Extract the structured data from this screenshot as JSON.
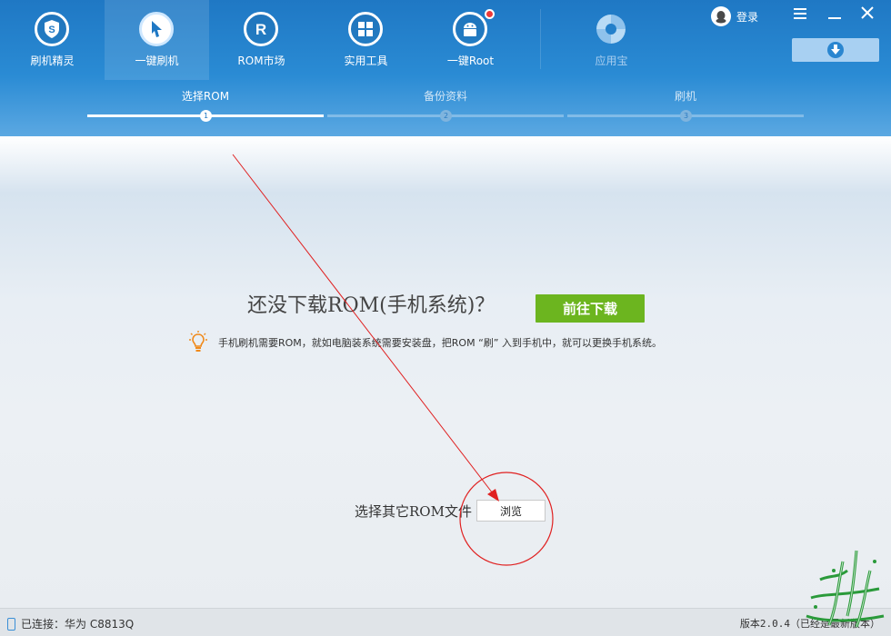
{
  "nav": {
    "items": [
      {
        "label": "刷机精灵",
        "icon": "shield-s-icon"
      },
      {
        "label": "一键刷机",
        "icon": "cursor-icon"
      },
      {
        "label": "ROM市场",
        "icon": "r-letter-icon"
      },
      {
        "label": "实用工具",
        "icon": "grid-icon"
      },
      {
        "label": "一键Root",
        "icon": "android-icon"
      }
    ],
    "active_index": 1,
    "app": {
      "label": "应用宝",
      "icon": "yingyongbao-logo-icon"
    }
  },
  "window": {
    "login_label": "登录",
    "menu_icon": "menu-icon",
    "minimize_icon": "minimize-icon",
    "close_icon": "close-icon",
    "download_icon": "download-icon"
  },
  "steps": [
    {
      "label": "选择ROM",
      "number": "1",
      "state": "active"
    },
    {
      "label": "备份资料",
      "number": "2",
      "state": "inactive"
    },
    {
      "label": "刷机",
      "number": "3",
      "state": "inactive"
    }
  ],
  "main": {
    "headline": "还没下载ROM(手机系统)？",
    "download_button": "前往下载",
    "tip": "手机刷机需要ROM，就如电脑装系统需要安装盘，把ROM “刷” 入到手机中，就可以更换手机系统。",
    "browse_label": "选择其它ROM文件",
    "browse_button": "浏览"
  },
  "status": {
    "connection": "已连接：华为 C8813Q",
    "version": "版本2.0.4（已经是最新版本）"
  },
  "colors": {
    "header_blue": "#1f78c4",
    "green_button": "#6cb51f",
    "annotation_red": "#e02020",
    "badge_red": "#ec3a3a"
  }
}
